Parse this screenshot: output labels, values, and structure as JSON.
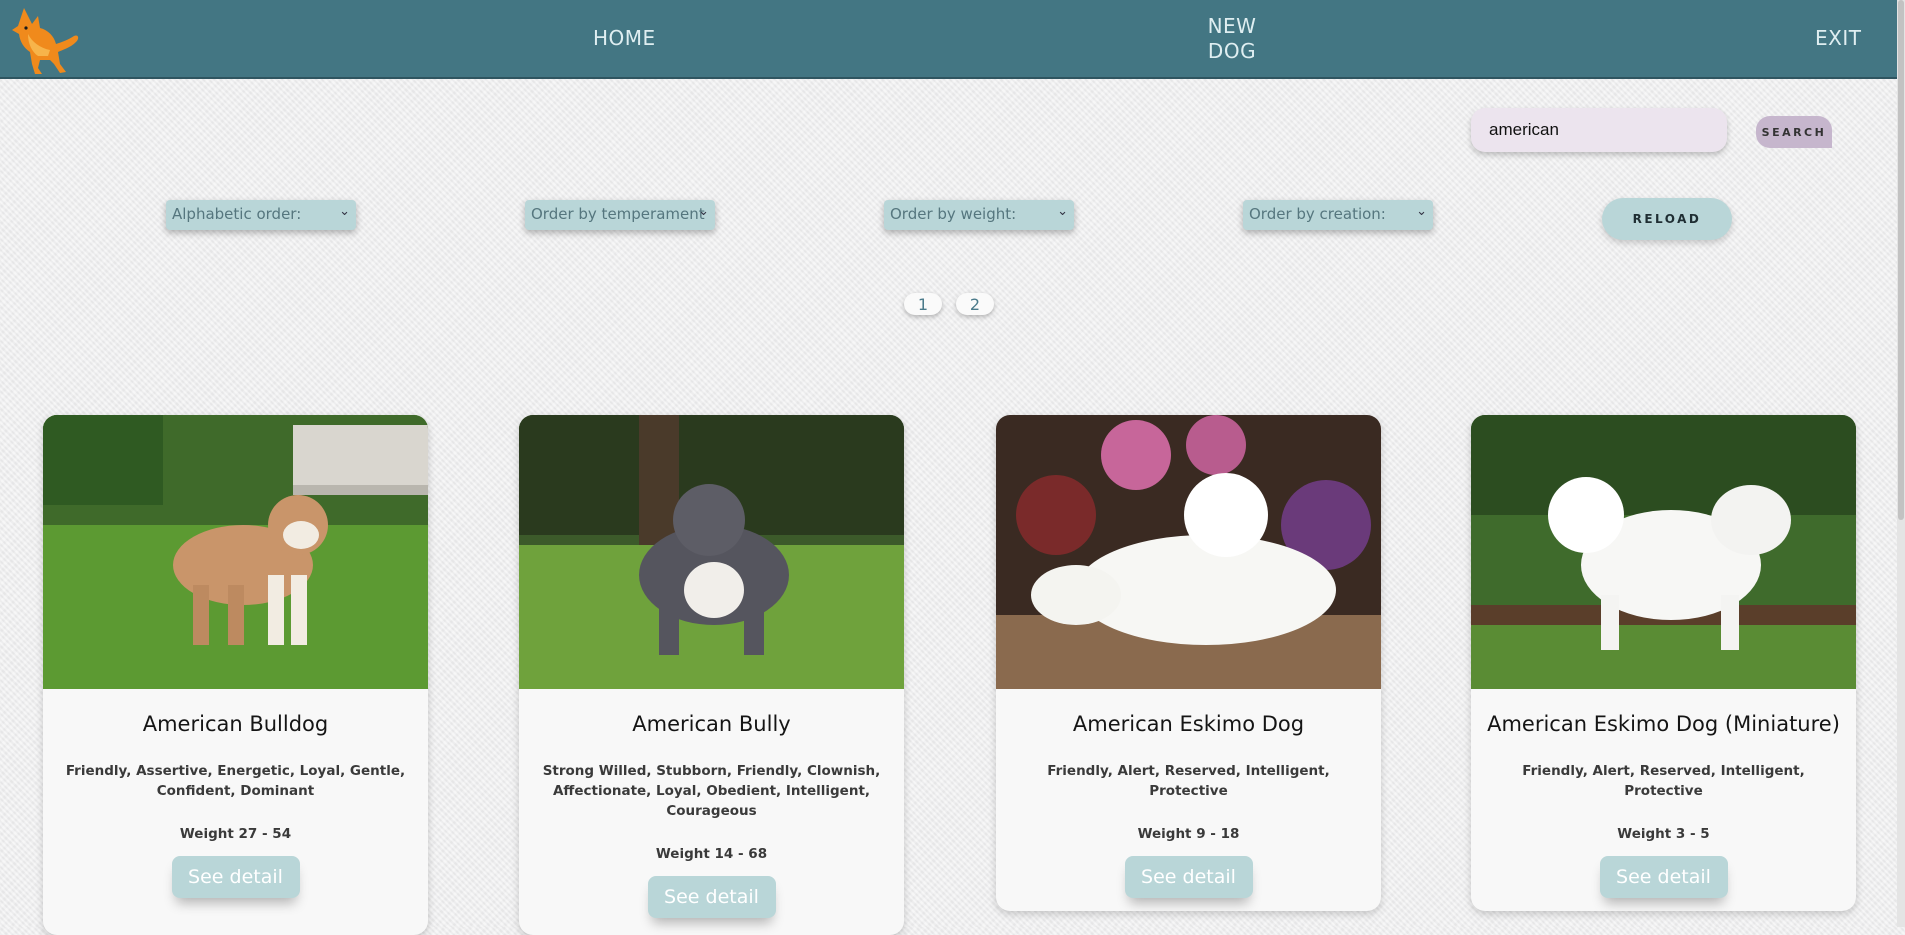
{
  "nav": {
    "home": "HOME",
    "new_dog_line1": "NEW",
    "new_dog_line2": "DOG",
    "exit": "EXIT",
    "logo_icon": "dog-logo"
  },
  "search": {
    "value": "american",
    "button": "SEARCH"
  },
  "filters": {
    "alphabetic": "Alphabetic order:",
    "temperament": "Order by temperament",
    "weight": "Order by weight:",
    "creation": "Order by creation:",
    "reload": "RELOAD"
  },
  "pagination": [
    "1",
    "2"
  ],
  "cards": [
    {
      "name": "American Bulldog",
      "temperament": "Friendly, Assertive, Energetic, Loyal, Gentle, Confident, Dominant",
      "weight": "Weight 27 - 54",
      "button": "See detail"
    },
    {
      "name": "American Bully",
      "temperament": "Strong Willed, Stubborn, Friendly, Clownish, Affectionate, Loyal, Obedient, Intelligent, Courageous",
      "weight": "Weight 14 - 68",
      "button": "See detail"
    },
    {
      "name": "American Eskimo Dog",
      "temperament": "Friendly, Alert, Reserved, Intelligent, Protective",
      "weight": "Weight 9 - 18",
      "button": "See detail"
    },
    {
      "name": "American Eskimo Dog (Miniature)",
      "temperament": "Friendly, Alert, Reserved, Intelligent, Protective",
      "weight": "Weight 3 - 5",
      "button": "See detail"
    }
  ],
  "colors": {
    "navbar": "#437683",
    "accent": "#b9d6d8",
    "search_button": "#c6b6cd",
    "search_input": "#ece4ee"
  }
}
